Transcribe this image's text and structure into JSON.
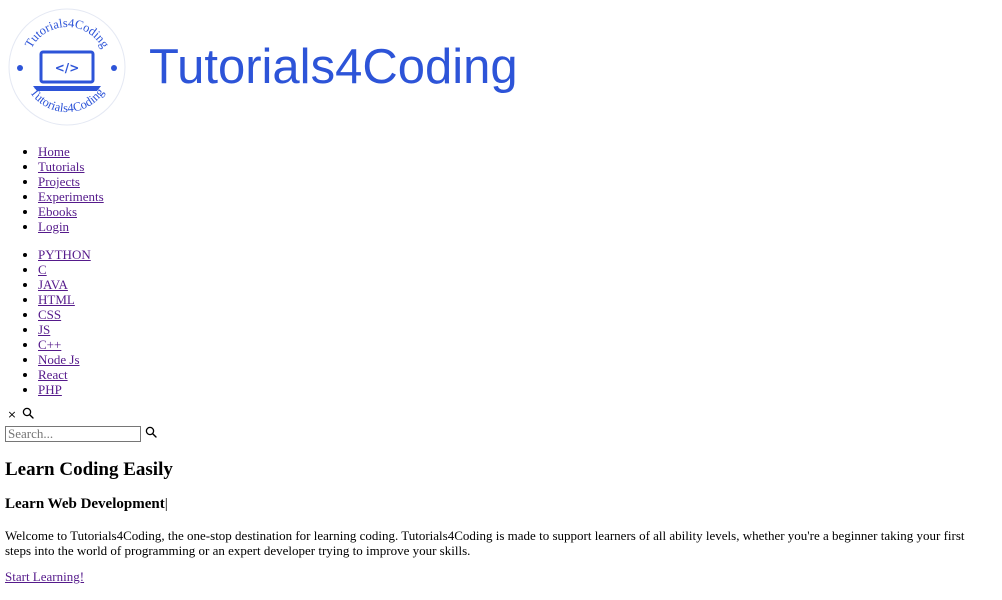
{
  "header": {
    "logo_text_top": "Tutorials4Coding",
    "logo_text_bottom": "Tutorials4Coding",
    "logo_code_glyph": "</>",
    "site_title": "Tutorials4Coding",
    "brand_color": "#2d54d8"
  },
  "main_nav": {
    "items": [
      {
        "label": "Home"
      },
      {
        "label": "Tutorials"
      },
      {
        "label": "Projects"
      },
      {
        "label": "Experiments"
      },
      {
        "label": "Ebooks"
      },
      {
        "label": "Login"
      }
    ]
  },
  "language_nav": {
    "items": [
      {
        "label": "PYTHON"
      },
      {
        "label": "C"
      },
      {
        "label": "JAVA"
      },
      {
        "label": "HTML"
      },
      {
        "label": "CSS"
      },
      {
        "label": "JS"
      },
      {
        "label": "C++"
      },
      {
        "label": "Node Js"
      },
      {
        "label": "React"
      },
      {
        "label": "PHP"
      }
    ]
  },
  "search": {
    "close_symbol": "×",
    "placeholder": "Search...",
    "value": ""
  },
  "hero": {
    "heading": "Learn Coding Easily",
    "subheading": "Learn Web Development",
    "subheading_cursor": "|",
    "intro": "Welcome to Tutorials4Coding, the one-stop destination for learning coding. Tutorials4Coding is made to support learners of all ability levels, whether you're a beginner taking your first steps into the world of programming or an expert developer trying to improve your skills.",
    "cta_label": "Start Learning!"
  },
  "colors": {
    "link_visited": "#551a8b",
    "text": "#000000",
    "background": "#ffffff"
  }
}
